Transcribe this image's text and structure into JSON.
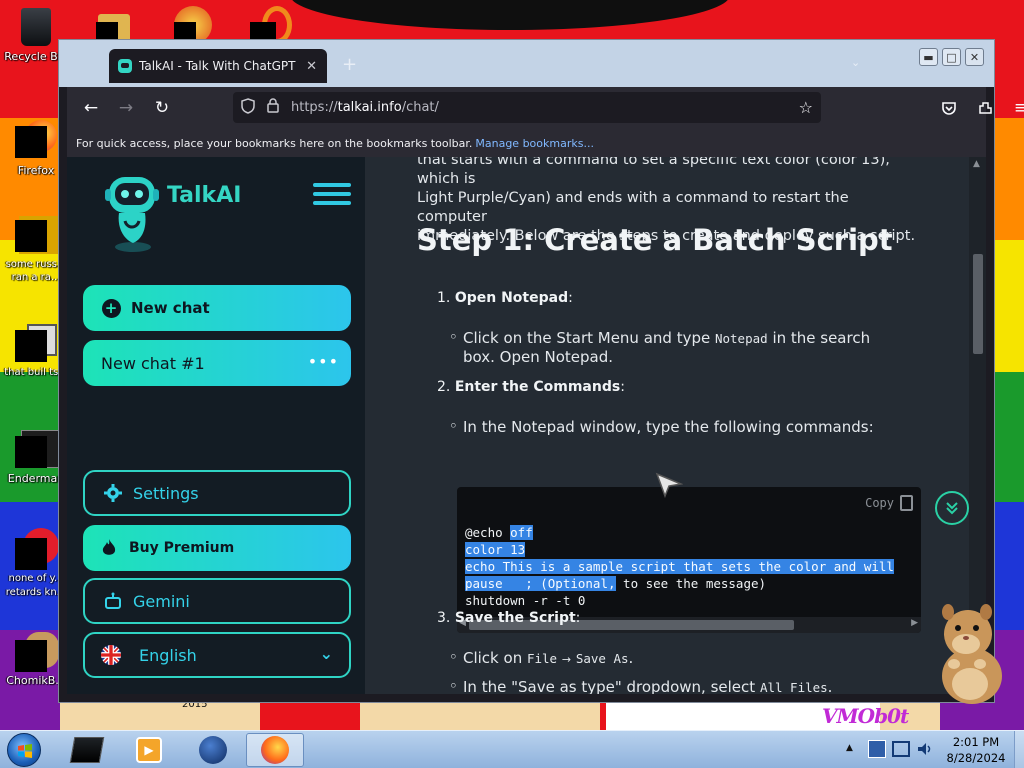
{
  "desktop": {
    "icons": [
      {
        "label": "Recycle Bin"
      },
      {
        "label": "Firefox"
      },
      {
        "label": "some russ... ran a ra..."
      },
      {
        "label": "that buil ts..."
      },
      {
        "label": "Enderman"
      },
      {
        "label": "none of y... retards kn..."
      },
      {
        "label": "ChomikB..."
      }
    ],
    "art_number": "2015",
    "art_signature": "VMOb0t"
  },
  "browser": {
    "tab_title": "TalkAI - Talk With ChatGPT",
    "new_tab_symbol": "+",
    "url_prefix": "https://",
    "url_host": "talkai.info",
    "url_path": "/chat/",
    "bookmarks_notice": "For quick access, place your bookmarks here on the bookmarks toolbar.",
    "bookmarks_link": "Manage bookmarks..."
  },
  "sidebar": {
    "brand": "TalkAI",
    "new_chat": "New chat",
    "chat_item": "New chat #1",
    "settings": "Settings",
    "buy_premium": "Buy Premium",
    "gemini": "Gemini",
    "language": "English"
  },
  "article": {
    "intro_lines": [
      "that starts with a command to set a specific text color (color 13), which is",
      "Light Purple/Cyan) and ends with a command to restart the computer",
      "immediately. Below are the steps to create and deploy such a script."
    ],
    "heading": "Step 1: Create a Batch Script",
    "steps": [
      {
        "num": "1.",
        "title": "Open Notepad",
        "suffix": ":"
      },
      {
        "num": "2.",
        "title": "Enter the Commands",
        "suffix": ":"
      },
      {
        "num": "3.",
        "title": "Save the Script",
        "suffix": ":"
      }
    ],
    "bullet1": {
      "pre": "Click on the Start Menu and type ",
      "code": "Notepad",
      "post": " in the search",
      "line2": "box. Open Notepad."
    },
    "bullet2": "In the Notepad window, type the following commands:",
    "bullet3": {
      "pre": "Click on ",
      "code1": "File",
      "arrow": "→",
      "code2": "Save As",
      "post": "."
    },
    "bullet4": {
      "pre": "In the \"Save as type\" dropdown, select ",
      "code": "All Files",
      "post": "."
    },
    "copy_label": "Copy",
    "code": {
      "l1a": "@echo ",
      "l1b": "off",
      "l2": "color 13",
      "l3": "echo This is a sample script that sets the color and will",
      "l4a": "pause   ; (Optional,",
      "l4b": " to see the message)",
      "l5": "shutdown -r -t 0"
    }
  },
  "taskbar": {
    "time": "2:01 PM",
    "date": "8/28/2024"
  },
  "colors": {
    "accent": "#2fd4c4",
    "sidebar_bg": "#131c24",
    "content_bg": "#242b33",
    "selection": "#3584e4"
  }
}
